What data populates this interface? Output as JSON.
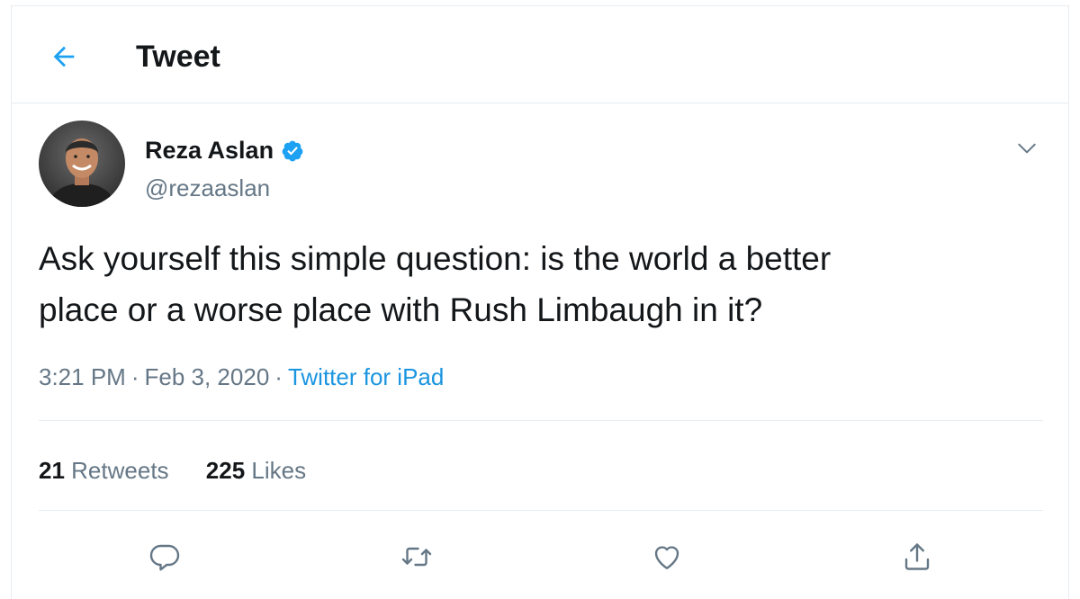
{
  "header": {
    "title": "Tweet",
    "back_icon": "arrow-left-icon",
    "accent_color": "#1da1f2"
  },
  "tweet": {
    "author": {
      "name": "Reza Aslan",
      "handle": "@rezaaslan",
      "verified": true,
      "verified_icon": "verified-badge-icon"
    },
    "text": "Ask yourself this simple question: is the world a better\nplace or a worse place with Rush Limbaugh in it?",
    "time": "3:21 PM",
    "separator": "·",
    "date": "Feb 3, 2020",
    "source": "Twitter for iPad",
    "menu_icon": "chevron-down-icon"
  },
  "stats": {
    "retweets_count": "21",
    "retweets_label": "Retweets",
    "likes_count": "225",
    "likes_label": "Likes"
  },
  "actions": [
    {
      "icon": "reply-icon"
    },
    {
      "icon": "retweet-icon"
    },
    {
      "icon": "like-icon"
    },
    {
      "icon": "share-icon"
    }
  ],
  "colors": {
    "text_primary": "#14171a",
    "text_secondary": "#657786",
    "link": "#1b95e0",
    "verified": "#1da1f2",
    "border": "#e6ecf0"
  }
}
